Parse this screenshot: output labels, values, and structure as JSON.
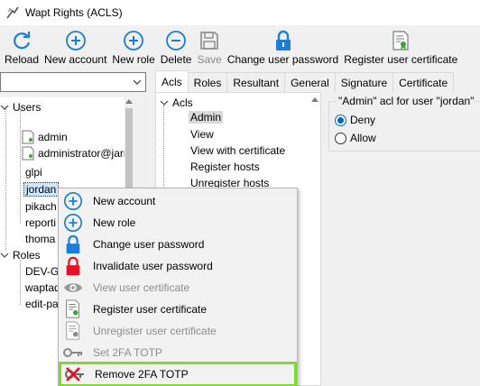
{
  "window": {
    "title": "Wapt Rights (ACLS)"
  },
  "toolbar": {
    "buttons": [
      {
        "label": "Reload",
        "icon": "reload-icon",
        "enabled": true
      },
      {
        "label": "New account",
        "icon": "plus-circle-icon",
        "enabled": true
      },
      {
        "label": "New role",
        "icon": "plus-circle-icon",
        "enabled": true
      },
      {
        "label": "Delete",
        "icon": "minus-circle-icon",
        "enabled": true
      },
      {
        "label": "Save",
        "icon": "floppy-icon",
        "enabled": false
      },
      {
        "label": "Change user password",
        "icon": "padlock-icon",
        "enabled": true
      },
      {
        "label": "Register user certificate",
        "icon": "certificate-icon",
        "enabled": true
      }
    ]
  },
  "left_tree": {
    "combo_value": "",
    "users_label": "Users",
    "users": [
      "admin",
      "administrator@jarr",
      "glpi",
      "jordan",
      "pikach",
      "reporti",
      "thoma"
    ],
    "roles_label": "Roles",
    "roles": [
      "DEV-Gr",
      "waptad",
      "edit-pa"
    ]
  },
  "tabs": [
    "Acls",
    "Roles",
    "Resultant",
    "General",
    "Signature",
    "Certificate"
  ],
  "acl_tree": {
    "root": "Acls",
    "items": [
      "Admin",
      "View",
      "View with certificate",
      "Register hosts",
      "Unregister hosts"
    ]
  },
  "acl_panel": {
    "group_title": "\"Admin\" acl for user \"jordan\"",
    "options": [
      {
        "label": "Deny",
        "selected": true
      },
      {
        "label": "Allow",
        "selected": false
      }
    ]
  },
  "context_menu": {
    "items": [
      {
        "label": "New account",
        "icon": "plus-circle-icon",
        "enabled": true
      },
      {
        "label": "New role",
        "icon": "plus-circle-icon",
        "enabled": true
      },
      {
        "label": "Change user password",
        "icon": "padlock-blue-icon",
        "enabled": true
      },
      {
        "label": "Invalidate user password",
        "icon": "padlock-red-icon",
        "enabled": true
      },
      {
        "label": "View user certificate",
        "icon": "eye-icon",
        "enabled": false
      },
      {
        "label": "Register user certificate",
        "icon": "certificate-icon",
        "enabled": true
      },
      {
        "label": "Unregister user certificate",
        "icon": "certificate-icon",
        "enabled": false
      },
      {
        "label": "Set 2FA TOTP",
        "icon": "key-icon",
        "enabled": false
      },
      {
        "label": "Remove 2FA TOTP",
        "icon": "key-remove-icon",
        "enabled": true,
        "highlighted": true
      }
    ]
  },
  "colors": {
    "accent": "#0067c0",
    "highlight": "#7ddb2c",
    "danger": "#e81123"
  }
}
